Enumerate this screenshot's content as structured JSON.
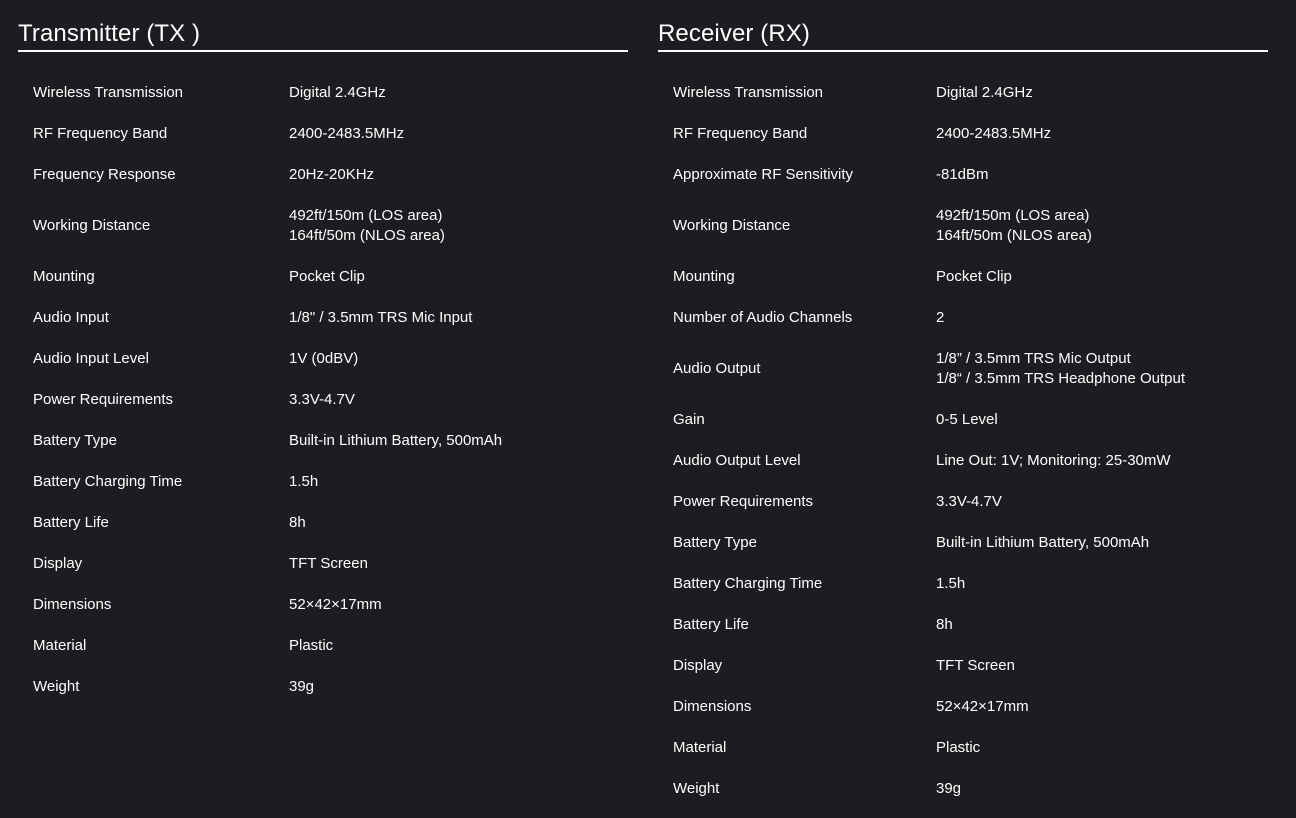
{
  "transmitter": {
    "title": "Transmitter (TX )",
    "rows": [
      {
        "label": "Wireless Transmission",
        "value": [
          "Digital 2.4GHz"
        ]
      },
      {
        "label": "RF Frequency Band",
        "value": [
          "2400-2483.5MHz"
        ]
      },
      {
        "label": "Frequency Response",
        "value": [
          "20Hz-20KHz"
        ]
      },
      {
        "label": "Working Distance",
        "value": [
          "492ft/150m (LOS area)",
          "164ft/50m (NLOS area)"
        ]
      },
      {
        "label": "Mounting",
        "value": [
          "Pocket Clip"
        ]
      },
      {
        "label": "Audio Input",
        "value": [
          "1/8\" / 3.5mm TRS Mic Input"
        ]
      },
      {
        "label": "Audio Input Level",
        "value": [
          "1V (0dBV)"
        ]
      },
      {
        "label": "Power Requirements",
        "value": [
          "3.3V-4.7V"
        ]
      },
      {
        "label": "Battery Type",
        "value": [
          "Built-in Lithium Battery, 500mAh"
        ]
      },
      {
        "label": "Battery Charging Time",
        "value": [
          "1.5h"
        ]
      },
      {
        "label": "Battery Life",
        "value": [
          "8h"
        ]
      },
      {
        "label": "Display",
        "value": [
          "TFT Screen"
        ]
      },
      {
        "label": "Dimensions",
        "value": [
          "52×42×17mm"
        ]
      },
      {
        "label": "Material",
        "value": [
          "Plastic"
        ]
      },
      {
        "label": "Weight",
        "value": [
          "39g"
        ]
      }
    ]
  },
  "receiver": {
    "title": "Receiver (RX)",
    "rows": [
      {
        "label": "Wireless Transmission",
        "value": [
          "Digital 2.4GHz"
        ]
      },
      {
        "label": "RF Frequency Band",
        "value": [
          "2400-2483.5MHz"
        ]
      },
      {
        "label": "Approximate RF Sensitivity",
        "value": [
          "-81dBm"
        ]
      },
      {
        "label": "Working Distance",
        "value": [
          "492ft/150m (LOS area)",
          "164ft/50m (NLOS area)"
        ]
      },
      {
        "label": "Mounting",
        "value": [
          "Pocket Clip"
        ]
      },
      {
        "label": "Number of Audio Channels",
        "value": [
          "2"
        ]
      },
      {
        "label": "Audio Output",
        "value": [
          "1/8” / 3.5mm TRS Mic Output",
          "1/8“ / 3.5mm TRS Headphone Output"
        ]
      },
      {
        "label": "Gain",
        "value": [
          "0-5 Level"
        ]
      },
      {
        "label": "Audio Output Level",
        "value": [
          "Line Out: 1V; Monitoring: 25-30mW"
        ]
      },
      {
        "label": "Power Requirements",
        "value": [
          "3.3V-4.7V"
        ]
      },
      {
        "label": "Battery Type",
        "value": [
          "Built-in Lithium Battery, 500mAh"
        ]
      },
      {
        "label": "Battery Charging Time",
        "value": [
          "1.5h"
        ]
      },
      {
        "label": "Battery Life",
        "value": [
          "8h"
        ]
      },
      {
        "label": "Display",
        "value": [
          "TFT Screen"
        ]
      },
      {
        "label": "Dimensions",
        "value": [
          "52×42×17mm"
        ]
      },
      {
        "label": "Material",
        "value": [
          "Plastic"
        ]
      },
      {
        "label": "Weight",
        "value": [
          "39g"
        ]
      }
    ]
  },
  "colors": {
    "background": "#1c1d21",
    "text": "#ffffff",
    "rule": "#ffffff"
  }
}
